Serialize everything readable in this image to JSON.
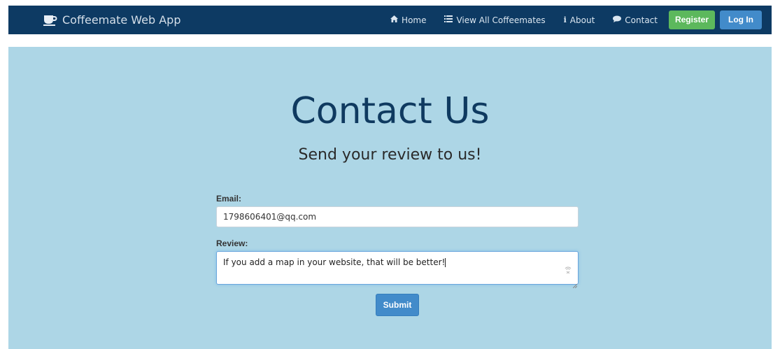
{
  "navbar": {
    "brand": "Coffeemate Web App",
    "brand_icon": "coffee-cup-icon",
    "items": [
      {
        "label": "Home",
        "icon": "home-icon"
      },
      {
        "label": "View All Coffeemates",
        "icon": "list-icon"
      },
      {
        "label": "About",
        "icon": "info-icon"
      },
      {
        "label": "Contact",
        "icon": "comment-icon"
      }
    ],
    "register_label": "Register",
    "login_label": "Log In"
  },
  "page": {
    "title": "Contact Us",
    "subtitle": "Send your review to us!"
  },
  "form": {
    "email_label": "Email:",
    "email_value": "1798606401@qq.com",
    "review_label": "Review:",
    "review_value": "If you add a map in your website, that will be better!",
    "submit_label": "Submit"
  },
  "colors": {
    "navbar": "#0d3a63",
    "hero": "#add6e6",
    "title": "#0f3a60",
    "register": "#5cb85c",
    "login": "#428bca",
    "submit": "#428bca"
  }
}
